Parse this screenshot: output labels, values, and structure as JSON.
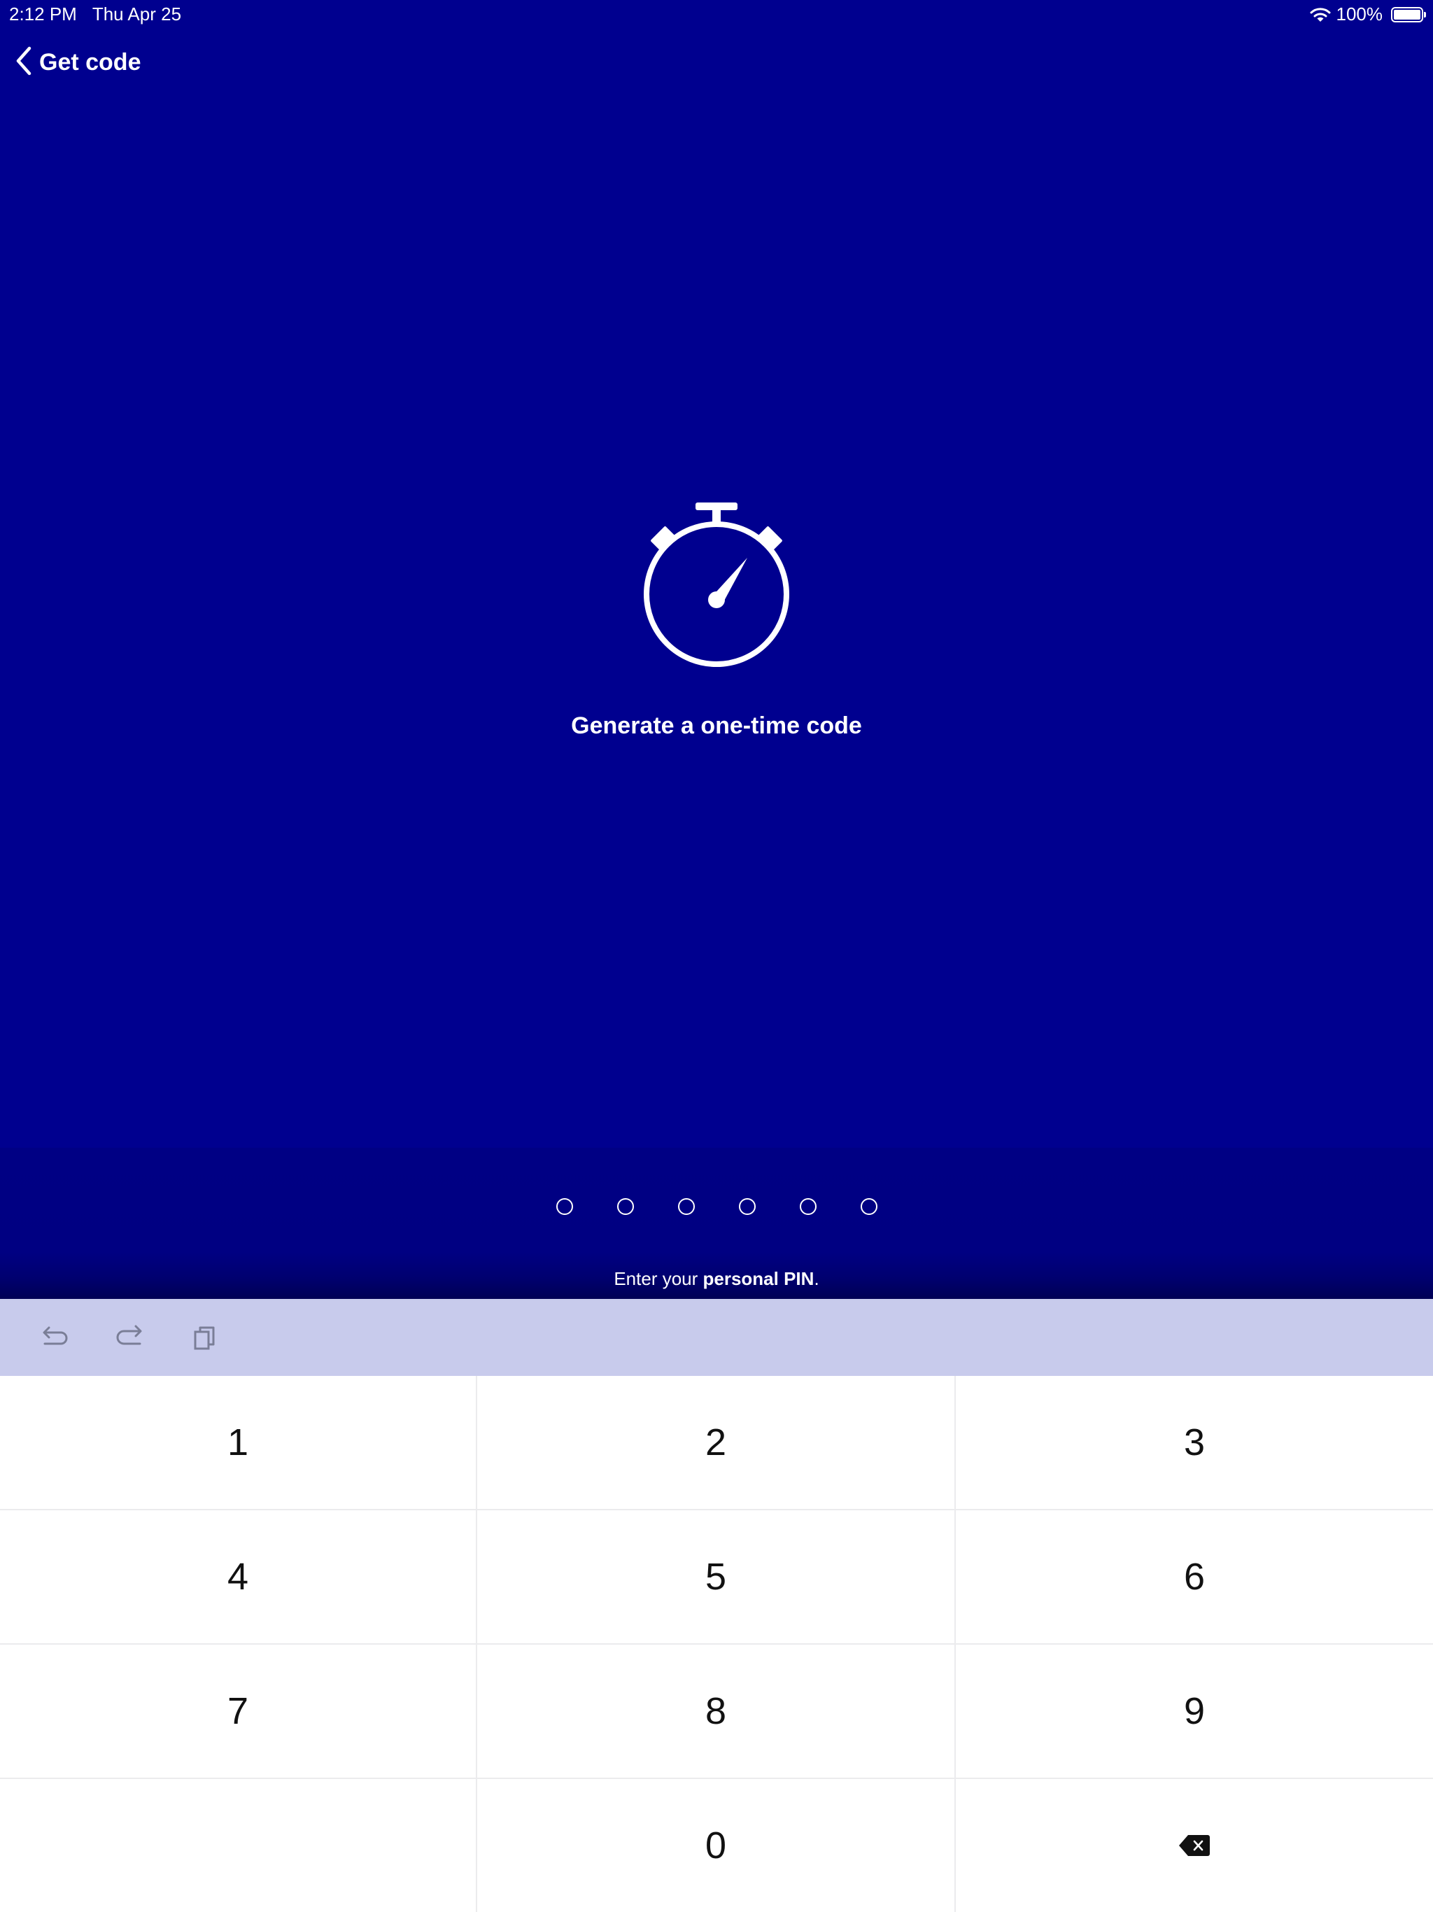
{
  "status_bar": {
    "time": "2:12 PM",
    "date": "Thu Apr 25",
    "battery": "100%",
    "battery_level": 1.0
  },
  "nav": {
    "back_label": "Get code"
  },
  "hero": {
    "icon": "stopwatch-icon",
    "title": "Generate a one-time code"
  },
  "pin": {
    "length": 6,
    "filled": 0,
    "prompt_prefix": "Enter your ",
    "prompt_bold": "personal PIN",
    "prompt_suffix": "."
  },
  "toolbar": {
    "buttons": [
      "undo-icon",
      "redo-icon",
      "paste-icon"
    ]
  },
  "keypad": {
    "keys": [
      "1",
      "2",
      "3",
      "4",
      "5",
      "6",
      "7",
      "8",
      "9",
      "",
      "0",
      "backspace-icon"
    ]
  },
  "colors": {
    "background": "#00008f",
    "toolbar": "#c8cbec",
    "keypad": "#ffffff",
    "text": "#ffffff"
  }
}
